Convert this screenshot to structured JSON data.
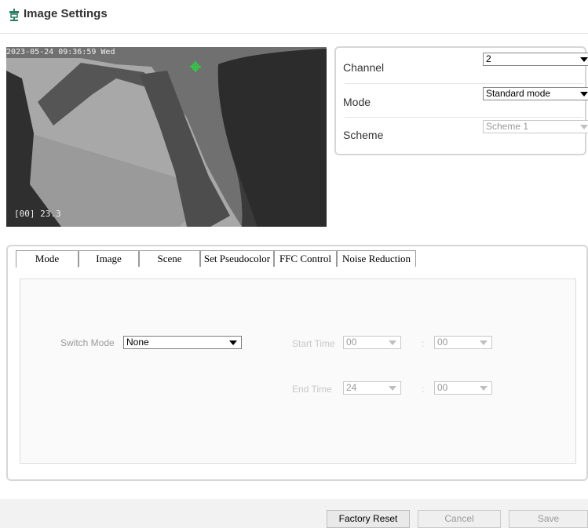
{
  "header": {
    "title": "Image Settings",
    "icon": "image-settings-icon"
  },
  "preview": {
    "timestamp": "2023-05-24 09:36:59 Wed",
    "temperature": "[00] 23.3"
  },
  "settings": {
    "channel": {
      "label": "Channel",
      "value": "2"
    },
    "mode": {
      "label": "Mode",
      "value": "Standard mode"
    },
    "scheme": {
      "label": "Scheme",
      "value": "Scheme 1"
    }
  },
  "tabs": [
    {
      "label": "Mode",
      "active": true
    },
    {
      "label": "Image"
    },
    {
      "label": "Scene"
    },
    {
      "label": "Set Pseudocolor"
    },
    {
      "label": "FFC Control"
    },
    {
      "label": "Noise Reduction"
    }
  ],
  "mode_tab": {
    "switch_mode_label": "Switch Mode",
    "switch_mode_value": "None",
    "start_time_label": "Start Time",
    "start_hour": "00",
    "start_minute": "00",
    "end_time_label": "End Time",
    "end_hour": "24",
    "end_minute": "00",
    "colon": ":"
  },
  "buttons": {
    "factory_reset": "Factory Reset",
    "cancel": "Cancel",
    "save": "Save"
  },
  "colors": {
    "accent_crosshair": "#2ecc40",
    "panel_border": "#d6d6d6"
  }
}
